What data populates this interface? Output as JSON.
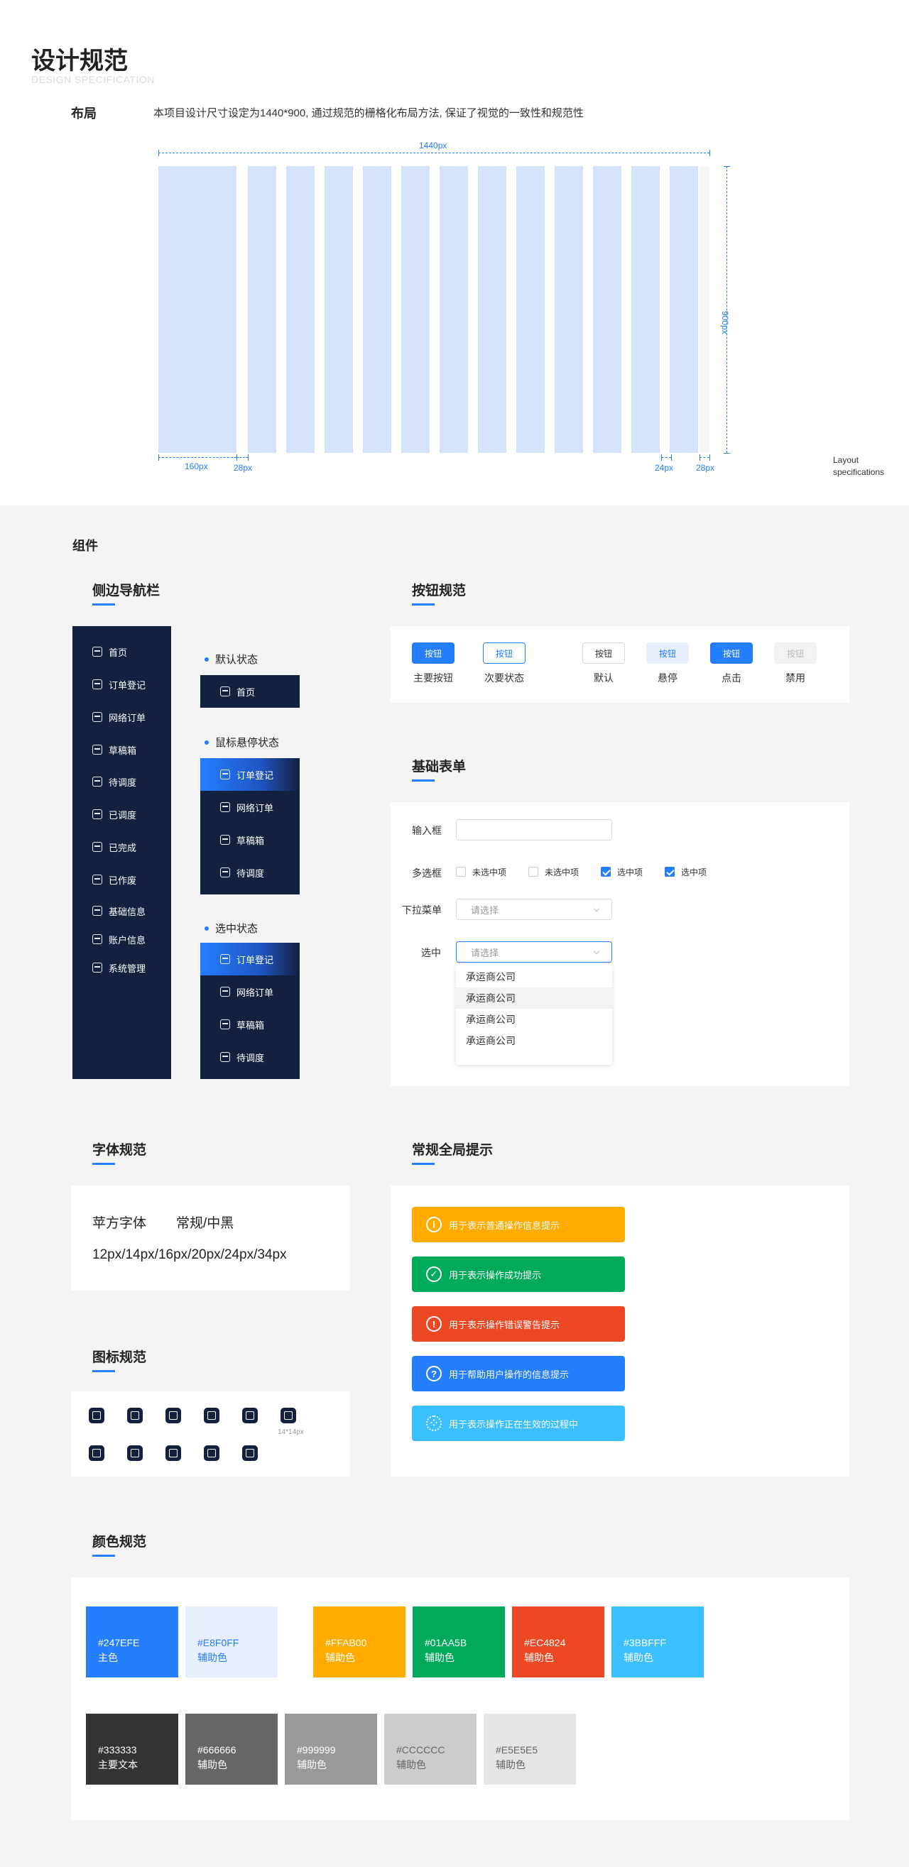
{
  "header": {
    "title": "设计规范",
    "subtitle": "DESIGN SPECIFICATION"
  },
  "layout": {
    "label": "布局",
    "description": "本项目设计尺寸设定为1440*900, 通过规范的栅格化布局方法, 保证了视觉的一致性和规范性",
    "width_label": "1440px",
    "height_label": "900px",
    "sidebar_label": "160px",
    "gutter_label": "28px",
    "gap_label": "24px",
    "margin_label": "28px",
    "note_line1": "Layout",
    "note_line2": "specifications"
  },
  "components": {
    "label": "组件"
  },
  "sidebar_section": {
    "title": "侧边导航栏",
    "items": [
      {
        "label": "首页",
        "icon": "home-icon"
      },
      {
        "label": "订单登记",
        "icon": "doc-icon"
      },
      {
        "label": "网络订单",
        "icon": "doc-icon"
      },
      {
        "label": "草稿箱",
        "icon": "inbox-icon"
      },
      {
        "label": "待调度",
        "icon": "list-icon"
      },
      {
        "label": "已调度",
        "icon": "monitor-icon"
      },
      {
        "label": "已完成",
        "icon": "check-doc-icon"
      },
      {
        "label": "已作废",
        "icon": "void-doc-icon"
      },
      {
        "label": "基础信息",
        "icon": "grid-icon"
      },
      {
        "label": "账户信息",
        "icon": "card-icon"
      },
      {
        "label": "系统管理",
        "icon": "gear-icon"
      }
    ],
    "states": {
      "default": {
        "label": "默认状态",
        "items": [
          "首页"
        ]
      },
      "hover": {
        "label": "鼠标悬停状态",
        "items": [
          "订单登记",
          "网络订单",
          "草稿箱",
          "待调度"
        ]
      },
      "selected": {
        "label": "选中状态",
        "items": [
          "订单登记",
          "网络订单",
          "草稿箱",
          "待调度"
        ]
      }
    }
  },
  "buttons": {
    "title": "按钮规范",
    "items": [
      {
        "text": "按钮",
        "label": "主要按钮"
      },
      {
        "text": "按钮",
        "label": "次要状态"
      },
      {
        "text": "按钮",
        "label": "默认"
      },
      {
        "text": "按钮",
        "label": "悬停"
      },
      {
        "text": "按钮",
        "label": "点击"
      },
      {
        "text": "按钮",
        "label": "禁用"
      }
    ]
  },
  "forms": {
    "title": "基础表单",
    "input_label": "输入框",
    "checkbox_label": "多选框",
    "checkboxes": [
      "未选中项",
      "未选中项",
      "选中项",
      "选中项"
    ],
    "select_label": "下拉菜单",
    "select_placeholder": "请选择",
    "selected_label": "选中",
    "selected_placeholder": "请选择",
    "options": [
      "承运商公司",
      "承运商公司",
      "承运商公司",
      "承运商公司"
    ]
  },
  "fonts": {
    "title": "字体规范",
    "family": "苹方字体",
    "weights": "常规/中黑",
    "sizes": "12px/14px/16px/20px/24px/34px"
  },
  "toasts": {
    "title": "常规全局提示",
    "items": [
      {
        "text": "用于表示普通操作信息提示",
        "color": "#FFAB00",
        "icon": "info-icon",
        "glyph": "i"
      },
      {
        "text": "用于表示操作成功提示",
        "color": "#01AA5B",
        "icon": "check-icon",
        "glyph": "✓"
      },
      {
        "text": "用于表示操作错误警告提示",
        "color": "#EC4824",
        "icon": "warning-icon",
        "glyph": "!"
      },
      {
        "text": "用于帮助用户操作的信息提示",
        "color": "#247EFE",
        "icon": "help-icon",
        "glyph": "?"
      },
      {
        "text": "用于表示操作正在生效的过程中",
        "color": "#3BBFFF",
        "icon": "loading-icon",
        "glyph": "⁘"
      }
    ]
  },
  "icons": {
    "title": "图标规范",
    "size_note": "14*14px"
  },
  "colors": {
    "title": "颜色规范",
    "row1": [
      {
        "hex": "#247EFE",
        "name": "主色"
      },
      {
        "hex": "#E8F0FF",
        "name": "辅助色"
      },
      {
        "hex": "#FFAB00",
        "name": "辅助色"
      },
      {
        "hex": "#01AA5B",
        "name": "辅助色"
      },
      {
        "hex": "#EC4824",
        "name": "辅助色"
      },
      {
        "hex": "#3BBFFF",
        "name": "辅助色"
      }
    ],
    "row2": [
      {
        "hex": "#333333",
        "name": "主要文本"
      },
      {
        "hex": "#666666",
        "name": "辅助色"
      },
      {
        "hex": "#999999",
        "name": "辅助色"
      },
      {
        "hex": "#CCCCCC",
        "name": "辅助色"
      },
      {
        "hex": "#E5E5E5",
        "name": "辅助色"
      }
    ]
  }
}
